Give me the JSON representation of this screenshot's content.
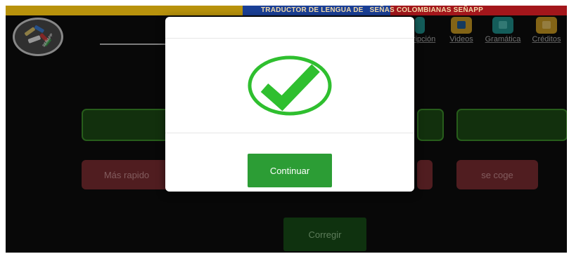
{
  "header": {
    "banner_title": "TRADUCTOR DE LENGUA DE   SEÑAS COLOMBIANAS SEÑAPP",
    "logo_text": "SEÑAPP"
  },
  "nav": {
    "items": [
      {
        "label": "ripción",
        "icon": "transcription-icon",
        "color": "#1f8f8a"
      },
      {
        "label": "Videos",
        "icon": "video-icon",
        "color": "#c99a22"
      },
      {
        "label": "Gramática",
        "icon": "grammar-icon",
        "color": "#1f8f8a"
      },
      {
        "label": "Créditos",
        "icon": "credits-icon",
        "color": "#c99a22"
      }
    ]
  },
  "exercise": {
    "options_red": [
      "Más rapido",
      "",
      "se coge"
    ],
    "correct_button": "Corregir"
  },
  "modal": {
    "icon": "checkmark-icon",
    "accent_color": "#2fbf2f",
    "continue_label": "Continuar"
  }
}
